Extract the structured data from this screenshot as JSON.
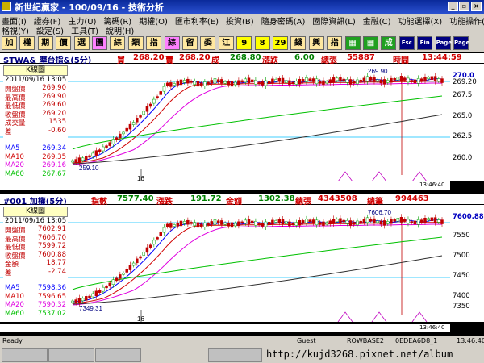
{
  "window": {
    "title": "新世紀贏家 - 100/09/16 - 技術分析",
    "minimize": "_",
    "restore": "▫",
    "close": "×"
  },
  "menu": {
    "row1": [
      "畫面(I)",
      "證券(F)",
      "主力(U)",
      "籌碼(R)",
      "期權(O)",
      "匯市利率(E)",
      "投資(B)",
      "隨身密碼(A)",
      "國際資訊(L)",
      "金融(C)",
      "功能選擇(X)",
      "功能操作(F)"
    ],
    "row2": [
      "格視(Y)",
      "設定(S)",
      "工具(T)",
      "說明(H)"
    ]
  },
  "toolbar": [
    "加",
    "權",
    "期",
    "價",
    "選",
    "圖",
    "綜",
    "類",
    "指",
    "綜",
    "留",
    "委",
    "江",
    "9",
    "8",
    "29",
    "錢",
    "興",
    "指",
    "▦",
    "▦",
    "成",
    "Esc",
    "Fin",
    "Page",
    "Page"
  ],
  "top": {
    "symbol": "STWA& 摩台指&(5分)",
    "buy_label": "買",
    "buy": "268.20",
    "sell_label": "賣",
    "sell": "268.20",
    "last_label": "成",
    "last": "268.80",
    "chg_label": "漲跌",
    "chg": "6.00",
    "vol_label": "總張",
    "vol": "55887",
    "time_label": "時間",
    "time": "13:44:59",
    "box_title": "K線圖",
    "box_date": "2011/09/16 13:05",
    "ohlc": [
      {
        "l": "開盤價",
        "v": "269.90"
      },
      {
        "l": "最高價",
        "v": "269.90"
      },
      {
        "l": "最低價",
        "v": "269.60"
      },
      {
        "l": "收盤價",
        "v": "269.20"
      },
      {
        "l": "成交量",
        "v": "1535"
      },
      {
        "l": "差",
        "v": "-0.60"
      }
    ],
    "ma": [
      {
        "l": "MA5",
        "v": "269.34"
      },
      {
        "l": "MA10",
        "v": "269.35"
      },
      {
        "l": "MA20",
        "v": "269.16"
      },
      {
        "l": "MA60",
        "v": "267.67"
      }
    ],
    "yticks": [
      "270.0",
      "269.20",
      "267.5",
      "265.0",
      "262.5",
      "260.0"
    ],
    "low_label": "259.10",
    "high_label": "269.90",
    "day_label": "16",
    "footer_time": "13:46:40"
  },
  "bottom": {
    "symbol": "#001 加權(5分)",
    "idx_label": "指數",
    "idx": "7577.40",
    "chg_label": "漲跌",
    "chg": "191.72",
    "amt_label": "金額",
    "amt": "1302.38",
    "vol_label": "總張",
    "vol": "4343508",
    "cnt_label": "總筆",
    "cnt": "994463",
    "box_title": "K線圖",
    "box_date": "2011/09/16 13:05",
    "ohlc": [
      {
        "l": "開盤價",
        "v": "7602.91"
      },
      {
        "l": "最高價",
        "v": "7606.70"
      },
      {
        "l": "最低價",
        "v": "7599.72"
      },
      {
        "l": "收盤價",
        "v": "7600.88"
      },
      {
        "l": "金額",
        "v": "18.77"
      },
      {
        "l": "差",
        "v": "-2.74"
      }
    ],
    "ma": [
      {
        "l": "MA5",
        "v": "7598.36"
      },
      {
        "l": "MA10",
        "v": "7596.65"
      },
      {
        "l": "MA20",
        "v": "7590.32"
      },
      {
        "l": "MA60",
        "v": "7537.02"
      }
    ],
    "yticks": [
      "7600.88",
      "7550",
      "7500",
      "7450",
      "7400",
      "7350"
    ],
    "low_label": "7349.31",
    "high_label": "7606.70",
    "day_label": "16",
    "footer_time": "13:46:40"
  },
  "status": {
    "ready": "Ready",
    "user": "Guest",
    "server": "ROWBASE2",
    "code": "0EDEA6D8_1",
    "time": "13:46:40"
  },
  "watermark": "http://kujd3268.pixnet.net/album",
  "colors": {
    "up": "#c00000",
    "down": "#00a000",
    "ma5": "#0000ff",
    "ma10": "#d00000",
    "ma20": "#e000e0",
    "ma60": "#00c000",
    "long": "#303030"
  }
}
